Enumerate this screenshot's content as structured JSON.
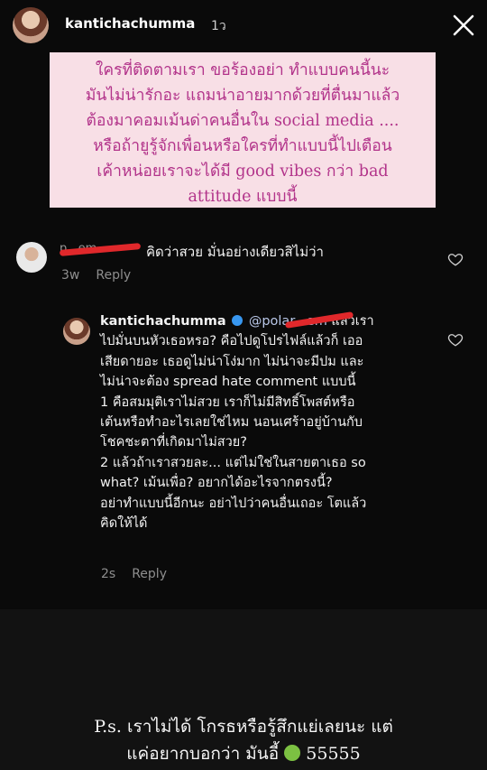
{
  "header": {
    "username": "kantichachumma",
    "time": "1ว"
  },
  "note": {
    "lines": [
      "ใครที่ติดตามเรา ขอร้องอย่า ทำแบบคนนี้นะ",
      "มันไม่น่ารักอะ แถมน่าอายมากด้วยที่ตื่นมาแล้ว",
      "ต้องมาคอมเม้นด่าคนอื่นใน social media ....",
      "หรือถ้ายูรู้จักเพื่อนหรือใครที่ทำแบบนี้ไปเตือน",
      "เค้าหน่อยเราจะได้มี good vibes กว่า bad",
      "attitude แบบนี้"
    ]
  },
  "comment1": {
    "handle_visible": "p...em",
    "text": "คิดว่าสวย มั่นอย่างเดียวสิไม่ว่า",
    "age": "3w",
    "reply_label": "Reply"
  },
  "reply": {
    "username": "kantichachumma",
    "mention": "@polar...em",
    "first_line_rest": " แล้วเรา",
    "lines": [
      "ไปมั่นบนหัวเธอหรอ? คือไปดูโปรไฟล์แล้วก็ เออ",
      "เสียดายอะ เธอดูไม่น่าโง่มาก ไม่น่าจะมีปม และ",
      "ไม่น่าจะต้อง spread hate comment แบบนี้",
      "1 คือสมมุติเราไม่สวย เราก็ไม่มีสิทธิ์โพสต์หรือ",
      "เต้นหรือทำอะไรเลยใช่ไหม นอนเศร้าอยู่บ้านกับ",
      "โชคชะตาที่เกิดมาไม่สวย?",
      "2 แล้วถ้าเราสวยละ... แต่ไม่ใช่ในสายตาเธอ so",
      "what? เม้นเพื่อ? อยากได้อะไรจากตรงนี้?",
      "อย่าทำแบบนี้อีกนะ อย่าไปว่าคนอื่นเถอะ โตแล้ว",
      "คิดให้ได้"
    ],
    "age": "2s",
    "reply_label": "Reply"
  },
  "ps": {
    "line1": "P.s. เราไม่ได้ โกรธหรือรู้สึกแย่เลยนะ แต่",
    "line2_pre": "แค่อยากบอกว่า มันอี้ ",
    "line2_post": " 55555",
    "emoji": "nauseated-face-icon"
  },
  "colors": {
    "note_bg": "#f8dfe6",
    "note_text": "#b2338a",
    "redaction": "#e0282b",
    "verified": "#3897f0"
  }
}
